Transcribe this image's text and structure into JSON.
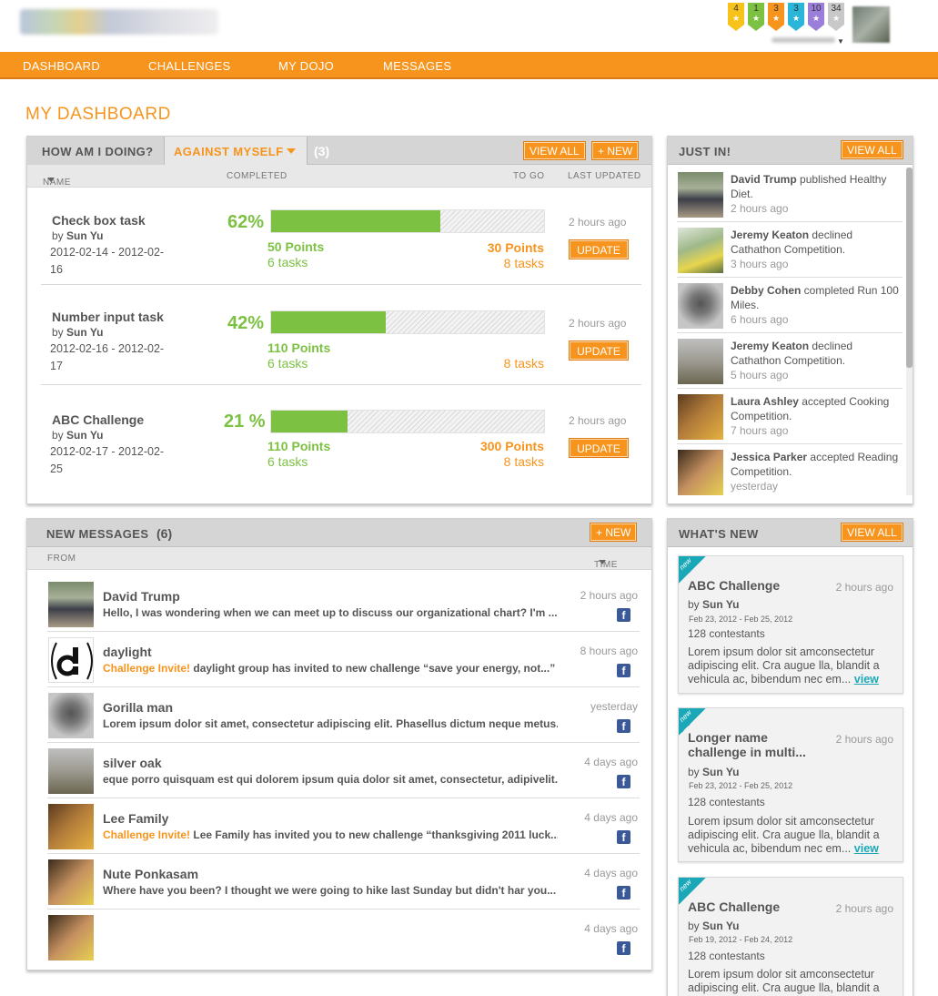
{
  "header": {
    "badges": [
      {
        "count": "4",
        "color": "#f7c21a"
      },
      {
        "count": "1",
        "color": "#7cc142"
      },
      {
        "count": "3",
        "color": "#f7941d"
      },
      {
        "count": "3",
        "color": "#29b6d8"
      },
      {
        "count": "10",
        "color": "#9b7ed9"
      },
      {
        "count": "34",
        "color": "#c8c8c8"
      }
    ]
  },
  "nav": {
    "dashboard": "DASHBOARD",
    "challenges": "CHALLENGES",
    "my_dojo": "MY DOJO",
    "messages": "MESSAGES"
  },
  "page_title": "MY DASHBOARD",
  "progress_panel": {
    "tab_how": "HOW AM I DOING?",
    "tab_against": "AGAINST MYSELF",
    "count": "(3)",
    "view_all": "VIEW ALL",
    "new": "+ NEW",
    "col_name": "NAME",
    "col_completed": "COMPLETED",
    "col_to_go": "TO GO",
    "col_last_updated": "LAST UPDATED",
    "update_label": "UPDATE",
    "tasks": [
      {
        "name": "Check box task",
        "by": "by",
        "owner": "Sun Yu",
        "dates": "2012-02-14 - 2012-02-16",
        "percent": "62%",
        "progress": 0.62,
        "done_points": "50 Points",
        "done_tasks": "6 tasks",
        "togo_points": "30 Points",
        "togo_tasks": "8 tasks",
        "updated": "2 hours ago"
      },
      {
        "name": "Number input task",
        "by": "by",
        "owner": "Sun Yu",
        "dates": "2012-02-16 - 2012-02-17",
        "percent": "42%",
        "progress": 0.42,
        "done_points": "110 Points",
        "done_tasks": "6 tasks",
        "togo_points": "",
        "togo_tasks": "8 tasks",
        "updated": "2 hours ago"
      },
      {
        "name": "ABC Challenge",
        "by": "by",
        "owner": "Sun Yu",
        "dates": "2012-02-17 - 2012-02-25",
        "percent": "21 %",
        "progress": 0.28,
        "done_points": "110 Points",
        "done_tasks": "6 tasks",
        "togo_points": "300 Points",
        "togo_tasks": "8 tasks",
        "updated": "2 hours ago"
      }
    ]
  },
  "just_in": {
    "title": "JUST IN!",
    "view_all": "VIEW ALL",
    "items": [
      {
        "who": "David Trump",
        "action": " published Healthy Diet.",
        "when": "2 hours ago"
      },
      {
        "who": "Jeremy Keaton",
        "action": " declined Cathathon Competition.",
        "when": "3 hours ago"
      },
      {
        "who": "Debby Cohen",
        "action": " completed Run 100 Miles.",
        "when": "6 hours ago"
      },
      {
        "who": "Jeremy Keaton",
        "action": " declined Cathathon Competition.",
        "when": "5 hours ago"
      },
      {
        "who": "Laura Ashley",
        "action": " accepted Cooking Competition.",
        "when": "7 hours ago"
      },
      {
        "who": "Jessica Parker",
        "action": " accepted Reading Competition.",
        "when": "yesterday"
      }
    ]
  },
  "messages_panel": {
    "title": "NEW MESSAGES",
    "count": "(6)",
    "new": "+ NEW",
    "col_from": "FROM",
    "col_time": "TIME",
    "items": [
      {
        "from": "David Trump",
        "invite": "",
        "text": "Hello, I was wondering when we can meet up to discuss our organizational chart? I'm ...",
        "time": "2 hours ago"
      },
      {
        "from": "daylight",
        "invite": "Challenge Invite!",
        "text": " daylight group has invited to new challenge “save your energy, not...”",
        "time": "8 hours ago"
      },
      {
        "from": "Gorilla man",
        "invite": "",
        "text": "Lorem ipsum dolor sit amet, consectetur adipiscing elit. Phasellus dictum neque metus...",
        "time": "yesterday"
      },
      {
        "from": "silver oak",
        "invite": "",
        "text": "eque porro quisquam est qui dolorem ipsum quia dolor sit amet, consectetur, adipivelit...",
        "time": "4 days ago"
      },
      {
        "from": "Lee Family",
        "invite": "Challenge Invite!",
        "text": "  Lee Family has invited you to new challenge “thanksgiving 2011 luck...”",
        "time": "4 days ago"
      },
      {
        "from": "Nute Ponkasam",
        "invite": "",
        "text": "Where have you been? I thought we were going to hike last Sunday but didn't har you...",
        "time": "4 days ago"
      },
      {
        "from": "",
        "invite": "",
        "text": "",
        "time": "4 days ago"
      }
    ]
  },
  "whats_new": {
    "title": "WHAT'S NEW",
    "view_all": "VIEW ALL",
    "ribbon": "new",
    "cards": [
      {
        "title": "ABC Challenge",
        "ago": "2 hours ago",
        "by": "by",
        "owner": "Sun Yu",
        "range": "Feb 23, 2012 - Feb 25, 2012",
        "contestants": "128 contestants",
        "lorem": "Lorem ipsum dolor sit amconsectetur adipiscing elit. Cra augue lla, blandit a vehicula ac, bibendum nec em...",
        "link": "view"
      },
      {
        "title": "Longer name challenge in multi...",
        "ago": "2 hours ago",
        "by": "by",
        "owner": "Sun Yu",
        "range": "Feb 23, 2012 - Feb 25, 2012",
        "contestants": "128 contestants",
        "lorem": "Lorem ipsum dolor sit amconsectetur adipiscing elit. Cra augue lla, blandit a vehicula ac, bibendum nec em...",
        "link": "view"
      },
      {
        "title": "ABC Challenge",
        "ago": "2 hours ago",
        "by": "by",
        "owner": "Sun Yu",
        "range": "Feb 19, 2012 - Feb 24, 2012",
        "contestants": "128 contestants",
        "lorem": "Lorem ipsum dolor sit amconsectetur adipiscing elit. Cra augue lla, blandit a vehicula ac, bibendum nec em...",
        "link": "view"
      }
    ]
  }
}
